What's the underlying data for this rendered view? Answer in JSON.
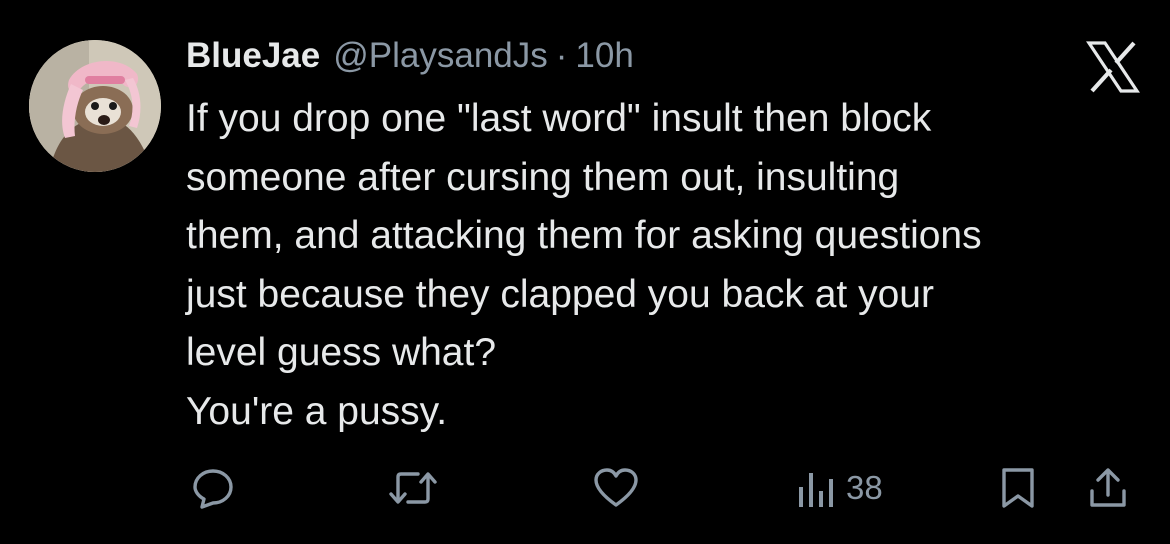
{
  "tweet": {
    "display_name": "BlueJae",
    "handle": "@PlaysandJs",
    "separator": "·",
    "time": "10h",
    "lines": [
      "If you drop one \"last word\" insult then block",
      "someone after cursing them out, insulting",
      "them, and attacking them for asking questions",
      "just because they clapped you back at your",
      "level guess what?",
      "You're a pussy."
    ],
    "avatar": "avatar-image",
    "brand_icon": "x-logo-icon"
  },
  "actions": {
    "reply_icon": "reply-icon",
    "repost_icon": "repost-icon",
    "like_icon": "heart-icon",
    "views_icon": "views-chart-icon",
    "views_count": "38",
    "bookmark_icon": "bookmark-icon",
    "share_icon": "share-icon"
  },
  "colors": {
    "background": "#000000",
    "primary_text": "#e7e9ea",
    "secondary_text": "#8b98a5"
  }
}
